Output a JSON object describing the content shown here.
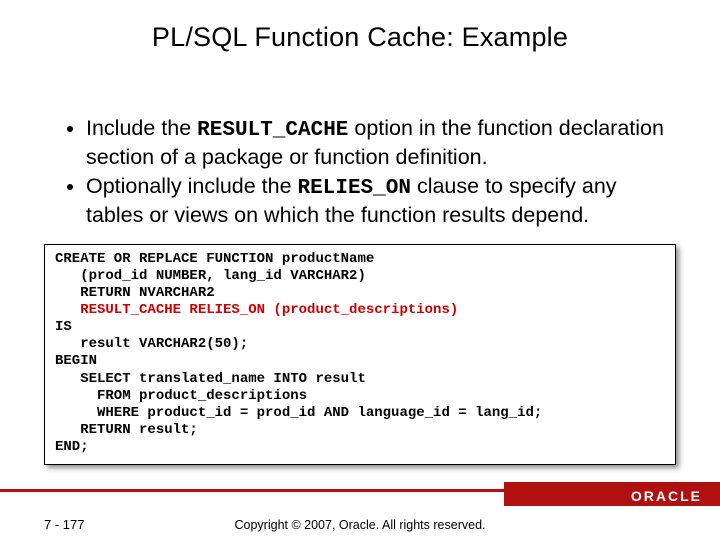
{
  "title": "PL/SQL Function Cache: Example",
  "bullets": [
    {
      "pre": "Include the ",
      "mono": "RESULT_CACHE",
      "post": " option in the function declaration section of a package or function definition."
    },
    {
      "pre": "Optionally include the ",
      "mono": "RELIES_ON",
      "post": " clause to specify any tables or views on which the function results depend."
    }
  ],
  "code": {
    "l1": "CREATE OR REPLACE FUNCTION productName",
    "l2": "   (prod_id NUMBER, lang_id VARCHAR2)",
    "l3": "   RETURN NVARCHAR2",
    "l4": "   RESULT_CACHE RELIES_ON (product_descriptions)",
    "l5": "IS",
    "l6": "   result VARCHAR2(50);",
    "l7": "BEGIN",
    "l8": "   SELECT translated_name INTO result",
    "l9": "     FROM product_descriptions",
    "l10": "     WHERE product_id = prod_id AND language_id = lang_id;",
    "l11": "   RETURN result;",
    "l12": "END;"
  },
  "logo": "ORACLE",
  "page": "7 - 177",
  "copyright": "Copyright © 2007, Oracle. All rights reserved."
}
